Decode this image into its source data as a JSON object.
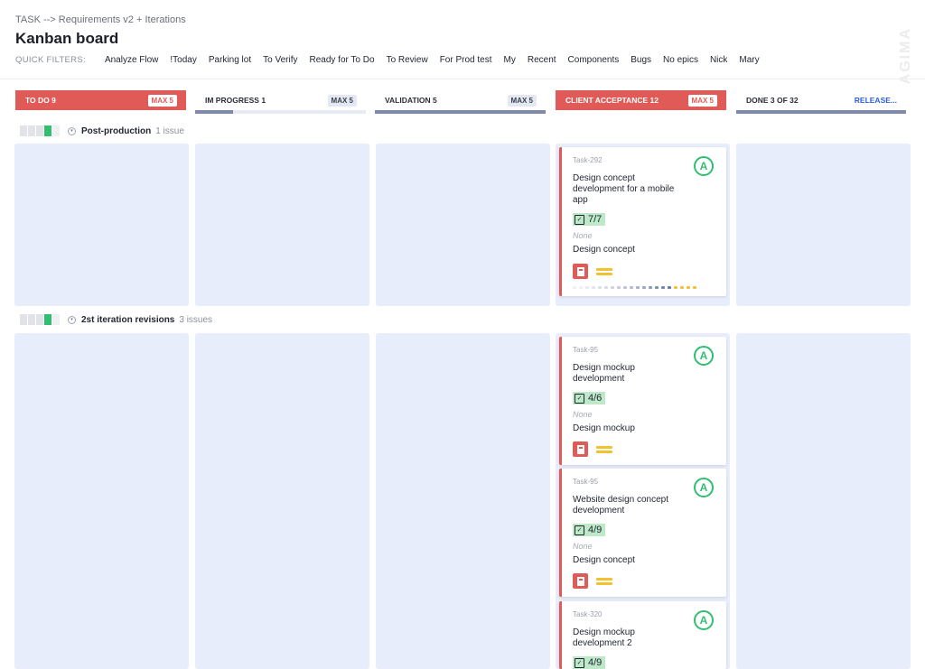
{
  "breadcrumb": "TASK --> Requirements v2 + Iterations",
  "page_title": "Kanban board",
  "watermark": "AGIMA",
  "quick_filters": {
    "label": "QUICK FILTERS:",
    "items": [
      "Analyze Flow",
      "!Today",
      "Parking lot",
      "To Verify",
      "Ready for To Do",
      "To Review",
      "For Prod test",
      "My",
      "Recent",
      "Components",
      "Bugs",
      "No epics",
      "Nick",
      "Mary"
    ]
  },
  "columns": [
    {
      "title": "TO DO 9",
      "badge": "MAX 5",
      "progress": 0
    },
    {
      "title": "IM PROGRESS 1",
      "badge": "MAX 5",
      "progress": 0.22
    },
    {
      "title": "VALIDATION 5",
      "badge": "MAX 5",
      "progress": 1.0
    },
    {
      "title": "CLIENT ACCEPTANCE 12",
      "badge": "MAX 5",
      "progress": 0
    },
    {
      "title": "DONE 3 OF 32",
      "link": "RELEASE...",
      "progress": 1.0
    }
  ],
  "swimlanes": [
    {
      "name": "Post-production",
      "count": "1 issue"
    },
    {
      "name": "2st iteration revisions",
      "count": "3 issues"
    }
  ],
  "cards": [
    {
      "key": "Task-292",
      "title": "Design concept development for a mobile app",
      "checklist": "7/7",
      "none": "None",
      "epic": "Design concept",
      "avatar": "A"
    },
    {
      "key": "Task-95",
      "title": "Design mockup development",
      "checklist": "4/6",
      "none": "None",
      "epic": "Design mockup",
      "avatar": "A"
    },
    {
      "key": "Task-95",
      "title": "Website design concept development",
      "checklist": "4/9",
      "none": "None",
      "epic": "Design concept",
      "avatar": "A"
    },
    {
      "key": "Task-320",
      "title": "Design mockup development 2",
      "checklist": "4/9",
      "avatar": "A"
    }
  ],
  "colors": {
    "accent_red": "#e05a57",
    "lane_bg": "#e8edfc",
    "green": "#2fbf71",
    "priority_yellow": "#f2c231",
    "link_blue": "#2f5fd8"
  },
  "icons": {
    "avatar": "agima-avatar-icon",
    "type": "bug-type-icon",
    "priority": "priority-medium-icon",
    "checklist": "checkbox-icon"
  }
}
